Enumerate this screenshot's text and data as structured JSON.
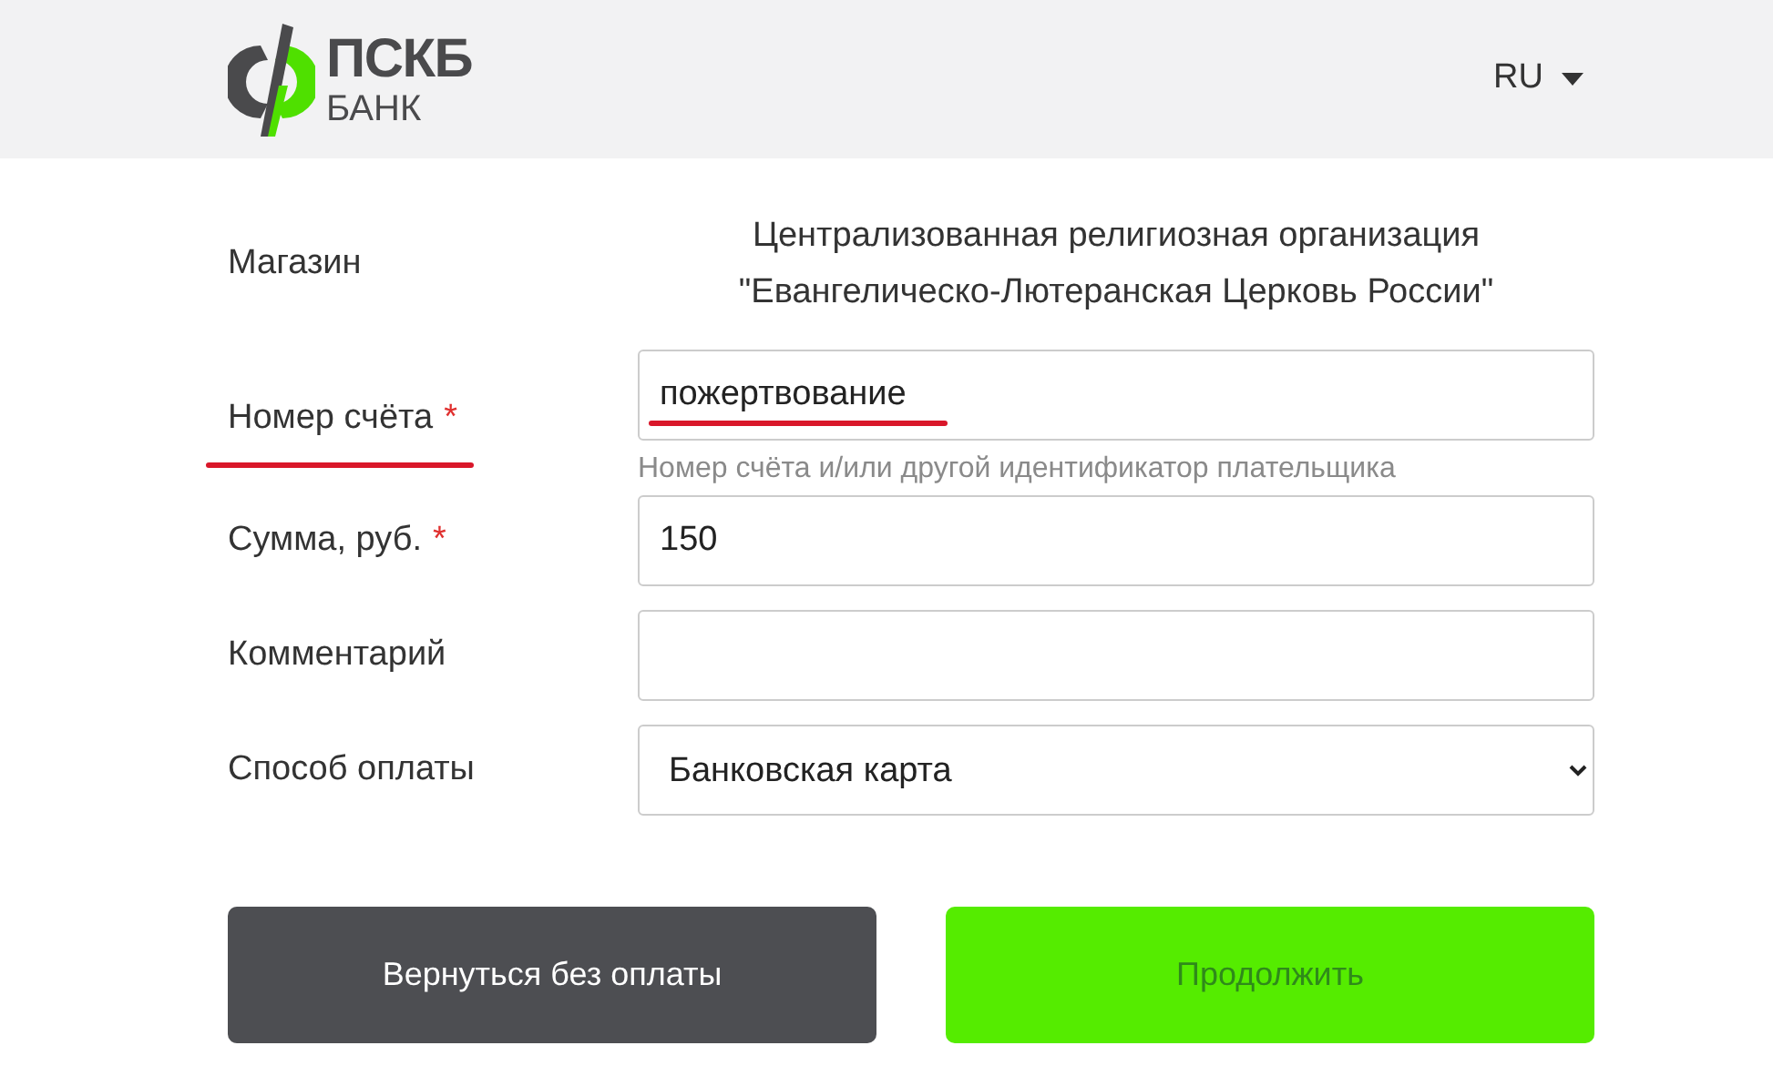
{
  "header": {
    "logo_top": "ПСКБ",
    "logo_bottom": "БАНК",
    "language": "RU"
  },
  "form": {
    "rows": [
      {
        "kind": "text",
        "label": "Магазин",
        "value": "Централизованная религиозная организация \"Евангелическо-Лютеранская Церковь России\""
      },
      {
        "kind": "input",
        "label": "Номер счёта",
        "required_mark": "*",
        "value": "пожертвование",
        "hint": "Номер счёта и/или другой идентификатор плательщика",
        "underlined": true
      },
      {
        "kind": "input",
        "label": "Сумма, руб.",
        "required_mark": "*",
        "value": "150"
      },
      {
        "kind": "input",
        "label": "Комментарий"
      },
      {
        "kind": "select",
        "label": "Способ оплаты",
        "value": "Банковская карта"
      }
    ]
  },
  "buttons": [
    {
      "kind": "secondary",
      "label": "Вернуться без оплаты"
    },
    {
      "kind": "primary",
      "label": "Продолжить"
    }
  ]
}
